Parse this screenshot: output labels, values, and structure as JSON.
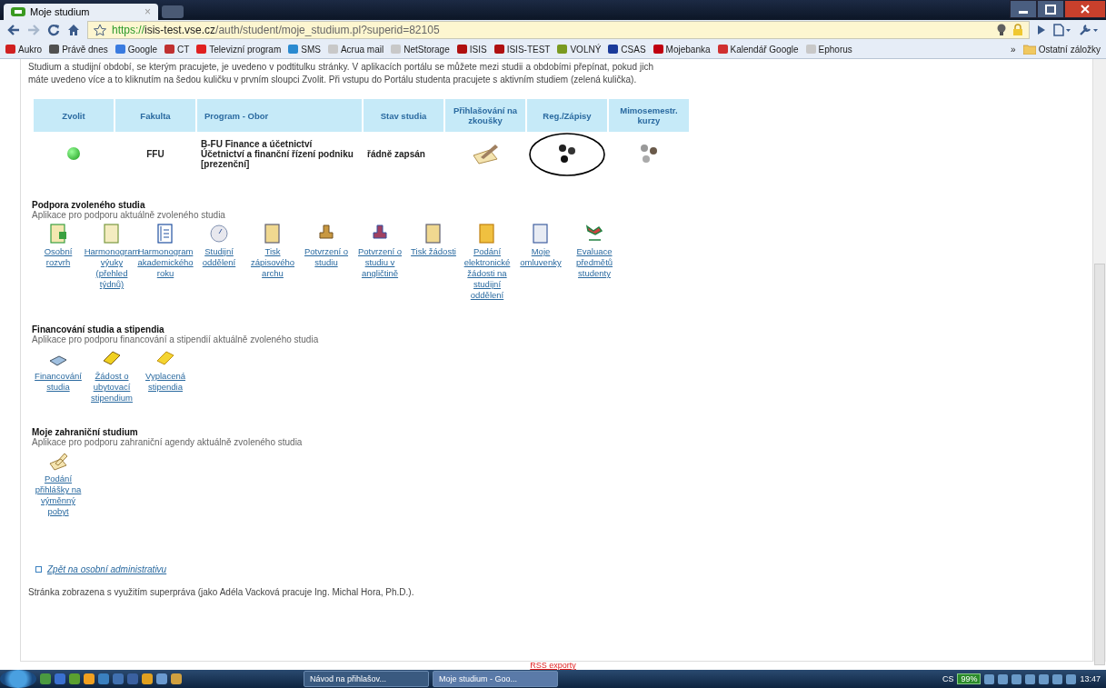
{
  "browser": {
    "tab": {
      "title": "Moje studium",
      "close": "×"
    },
    "url": {
      "scheme": "https://",
      "host": "isis-test.vse.cz",
      "path": "/auth/student/moje_studium.pl?superid=82105"
    },
    "bookmarks": [
      {
        "label": "Aukro",
        "color": "#d02020"
      },
      {
        "label": "Právě dnes",
        "color": "#505050"
      },
      {
        "label": "Google",
        "color": "#3a7be0"
      },
      {
        "label": "CT",
        "color": "#c03030"
      },
      {
        "label": "Televizní program",
        "color": "#e02020"
      },
      {
        "label": "SMS",
        "color": "#2a8ad0"
      },
      {
        "label": "Acrua mail",
        "color": "#c8c8c8"
      },
      {
        "label": "NetStorage",
        "color": "#c8c8c8"
      },
      {
        "label": "ISIS",
        "color": "#b01010"
      },
      {
        "label": "ISIS-TEST",
        "color": "#b01010"
      },
      {
        "label": "VOLNÝ",
        "color": "#7a9a20"
      },
      {
        "label": "CSAS",
        "color": "#1a3a9a"
      },
      {
        "label": "Mojebanka",
        "color": "#c00010"
      },
      {
        "label": "Kalendář Google",
        "color": "#d03030"
      },
      {
        "label": "Ephorus",
        "color": "#c8c8c8"
      }
    ],
    "more": "»",
    "other_bookmarks": "Ostatní záložky"
  },
  "page": {
    "intro": "Studium a studijní období, se kterým pracujete, je uvedeno v podtitulku stránky. V aplikacích portálu se můžete mezi studii a obdobími přepínat, pokud jich máte uvedeno více a to kliknutím na šedou kuličku v prvním sloupci Zvolit. Při vstupu do Portálu studenta pracujete s aktivním studiem (zelená kulička).",
    "table": {
      "columns": [
        "Zvolit",
        "Fakulta",
        "Program - Obor",
        "Stav studia",
        "Přihlašování na zkoušky",
        "Reg./Zápisy",
        "Mimosemestr. kurzy"
      ],
      "rows": [
        {
          "selected": true,
          "faculty": "FFU",
          "program": [
            "B-FU Finance a účetnictví",
            "Účetnictví a finanční řízení podniku",
            "[prezenční]"
          ],
          "status": "řádně zapsán",
          "cells": [
            {
              "kind": "pencil",
              "highlighted": false
            },
            {
              "kind": "paws",
              "highlighted": true
            },
            {
              "kind": "paws-faded",
              "highlighted": false
            }
          ]
        }
      ]
    },
    "sections": [
      {
        "title": "Podpora zvoleného studia",
        "subtitle": "Aplikace pro podporu aktuálně zvoleného studia",
        "apps": [
          {
            "kind": "sheet",
            "label": "Osobní rozvrh"
          },
          {
            "kind": "page",
            "label": "Harmonogram výuky (přehled týdnů)"
          },
          {
            "kind": "list",
            "label": "Harmonogram akademického roku"
          },
          {
            "kind": "clock",
            "label": "Studijní oddělení"
          },
          {
            "kind": "print",
            "label": "Tisk zápisového archu"
          },
          {
            "kind": "stamp",
            "label": "Potvrzení o studiu"
          },
          {
            "kind": "stamp-flag",
            "label": "Potvrzení o studiu v angličtině"
          },
          {
            "kind": "print",
            "label": "Tisk žádosti"
          },
          {
            "kind": "form",
            "label": "Podání elektronické žádosti na studijní oddělení"
          },
          {
            "kind": "notebook",
            "label": "Moje omluvenky"
          },
          {
            "kind": "evaluation",
            "label": "Evaluace předmětů studenty"
          }
        ]
      },
      {
        "title": "Financování studia a stipendia",
        "subtitle": "Aplikace pro podporu financování a stipendií aktuálně zvoleného studia",
        "apps": [
          {
            "kind": "money",
            "label": "Financování studia"
          },
          {
            "kind": "gold-stack",
            "label": "Žádost o ubytovací stipendium"
          },
          {
            "kind": "gold",
            "label": "Vyplacená stipendia"
          }
        ]
      },
      {
        "title": "Moje zahraniční studium",
        "subtitle": "Aplikace pro podporu zahraniční agendy aktuálně zvoleného studia",
        "apps": [
          {
            "kind": "pencil",
            "label": "Podání přihlášky na výměnný pobyt"
          }
        ]
      }
    ],
    "back_link": "Zpět na osobní administrativu",
    "footer": "Stránka zobrazena s využitím superpráva (jako Adéla Vacková pracuje Ing. Michal Hora, Ph.D.).",
    "rss": "RSS exporty"
  },
  "taskbar": {
    "tasks": [
      {
        "label": "Návod na přihlašov...",
        "selected": false
      },
      {
        "label": "Moje studium - Goo...",
        "selected": true
      }
    ],
    "language": "CS",
    "battery": "99%",
    "clock": "13:47"
  }
}
